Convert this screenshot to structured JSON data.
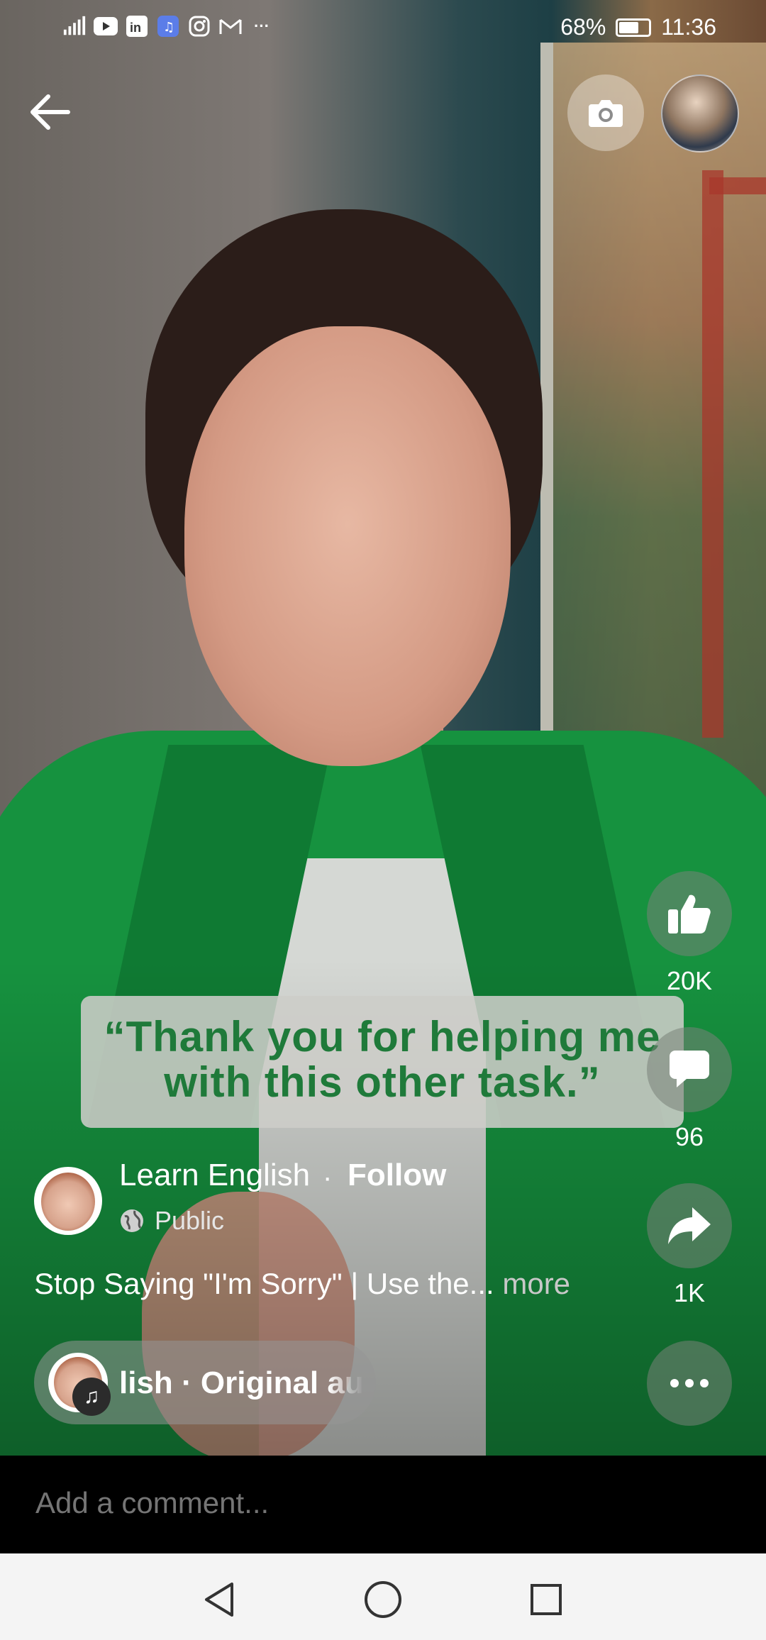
{
  "status_bar": {
    "battery": "68%",
    "battery_level": 0.68,
    "time": "11:36",
    "overflow": "···"
  },
  "video": {
    "caption": "“Thank you for helping me with this other task.”"
  },
  "actions": {
    "like_count": "20K",
    "comment_count": "96",
    "share_count": "1K"
  },
  "post": {
    "author": "Learn English",
    "separator": "·",
    "follow_label": "Follow",
    "audience": "Public",
    "description": "Stop Saying \"I'm Sorry\" | Use the...",
    "more_label": "more",
    "audio_text": "lish · Original au"
  },
  "comment": {
    "placeholder": "Add a comment..."
  },
  "colors": {
    "caption_green": "#1f7a3a",
    "jacket_green": "#16923f"
  }
}
